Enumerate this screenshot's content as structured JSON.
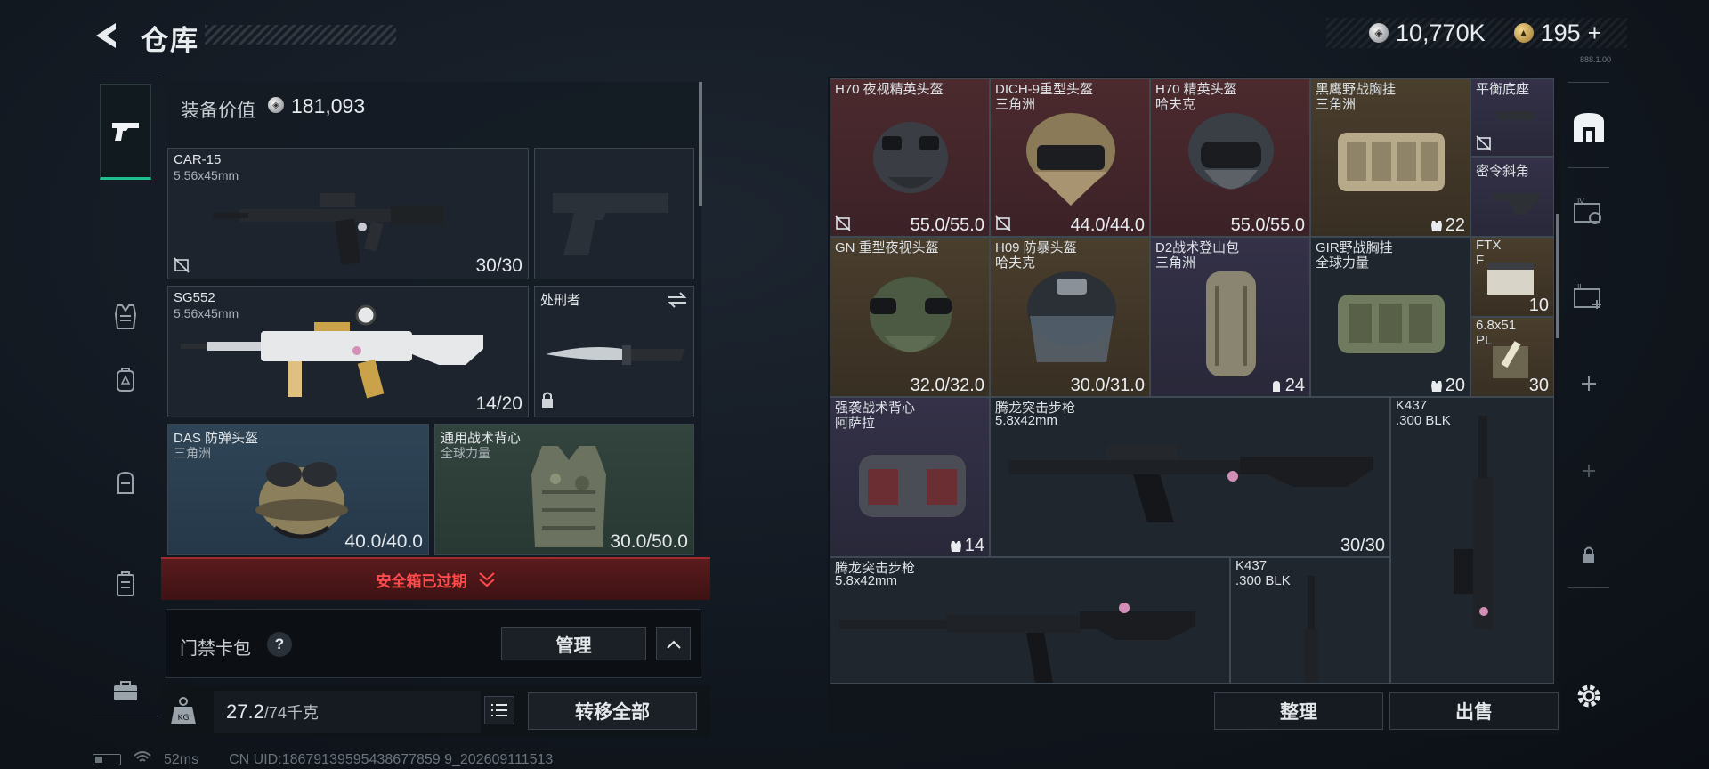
{
  "header": {
    "title": "仓库",
    "silver_amount": "10,770K",
    "gold_amount": "195",
    "gold_plus": "+",
    "version": "888.1.00"
  },
  "loadout": {
    "value_label": "装备价值",
    "value": "181,093",
    "slots": {
      "primary": {
        "name": "CAR-15",
        "caliber": "5.56x45mm",
        "ammo": "30/30"
      },
      "secondary": {
        "name": "SG552",
        "caliber": "5.56x45mm",
        "ammo": "14/20"
      },
      "melee": {
        "name": "处刑者"
      },
      "helmet": {
        "name": "DAS 防弹头盔",
        "origin": "三角洲",
        "durability": "40.0/40.0"
      },
      "armor": {
        "name": "通用战术背心",
        "origin": "全球力量",
        "durability": "30.0/50.0"
      }
    },
    "safebox_status": "安全箱已过期",
    "card_pack_label": "门禁卡包",
    "help_label": "?",
    "manage_label": "管理",
    "weight_current": "27.2",
    "weight_max": "/74千克",
    "transfer_all_label": "转移全部"
  },
  "status_bar": {
    "ping": "52ms",
    "uid": "CN UID:18679139595438677859 9_202609111513"
  },
  "stash": {
    "items": [
      {
        "name": "H70 夜视精英头盔",
        "sub": "",
        "value": "55.0/55.0",
        "rarity": "red"
      },
      {
        "name": "DICH-9重型头盔",
        "sub": "三角洲",
        "value": "44.0/44.0",
        "rarity": "red"
      },
      {
        "name": "H70 精英头盔",
        "sub": "哈夫克",
        "value": "55.0/55.0",
        "rarity": "red"
      },
      {
        "name": "黑鹰野战胸挂",
        "sub": "三角洲",
        "value": "22",
        "rarity": "gold"
      },
      {
        "name": "平衡底座",
        "sub": "",
        "value": "",
        "rarity": "purple"
      },
      {
        "name": "密令斜角",
        "sub": "",
        "value": "",
        "rarity": "purple"
      },
      {
        "name": "GN 重型夜视头盔",
        "sub": "",
        "value": "32.0/32.0",
        "rarity": "gold"
      },
      {
        "name": "H09 防暴头盔",
        "sub": "哈夫克",
        "value": "30.0/31.0",
        "rarity": "gold"
      },
      {
        "name": "D2战术登山包",
        "sub": "三角洲",
        "value": "24",
        "rarity": "purple"
      },
      {
        "name": "GIR野战胸挂",
        "sub": "全球力量",
        "value": "20",
        "rarity": "dark"
      },
      {
        "name": "FTX",
        "sub": "F",
        "value": "10",
        "rarity": "gold"
      },
      {
        "name": "6.8x51",
        "sub": "PL",
        "value": "30",
        "rarity": "gold"
      },
      {
        "name": "强袭战术背心",
        "sub": "阿萨拉",
        "value": "14",
        "rarity": "purple"
      },
      {
        "name": "腾龙突击步枪",
        "sub": "5.8x42mm",
        "value": "30/30",
        "rarity": "dark"
      },
      {
        "name": "K437",
        "sub": ".300 BLK",
        "value": "",
        "rarity": "dark"
      },
      {
        "name": "腾龙突击步枪",
        "sub": "5.8x42mm",
        "value": "",
        "rarity": "dark"
      },
      {
        "name": "K437",
        "sub": ".300 BLK",
        "value": "",
        "rarity": "dark"
      }
    ],
    "sort_label": "整理",
    "sell_label": "出售"
  },
  "colors": {
    "accent_green": "#1fbf8f",
    "expired_red": "#ff4b4b",
    "rarity_red": "#4c2a2e",
    "rarity_gold": "#4a3e2d",
    "rarity_purple": "#343148"
  }
}
